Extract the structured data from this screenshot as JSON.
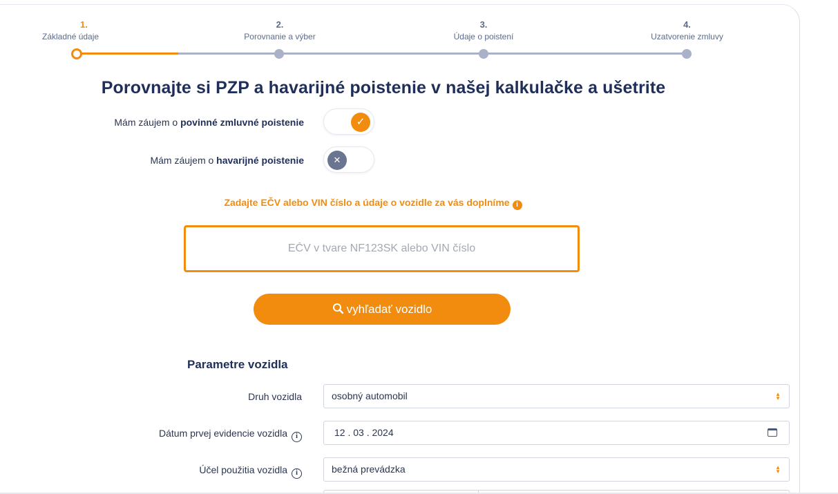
{
  "steps": [
    {
      "number": "1.",
      "label": "Základné údaje"
    },
    {
      "number": "2.",
      "label": "Porovnanie a výber"
    },
    {
      "number": "3.",
      "label": "Údaje o poistení"
    },
    {
      "number": "4.",
      "label": "Uzatvorenie zmluvy"
    }
  ],
  "progress": {
    "current_step": 1,
    "total_steps": 4
  },
  "title": "Porovnajte si PZP a havarijné poistenie v našej kalkulačke a ušetrite",
  "toggles": {
    "pzp": {
      "prefix": "Mám záujem o ",
      "bold": "povinné zmluvné poistenie",
      "state": "on",
      "glyph": "✓"
    },
    "havarijne": {
      "prefix": "Mám záujem o ",
      "bold": "havarijné poistenie",
      "state": "off",
      "glyph": "✕"
    }
  },
  "search": {
    "hint": "Zadajte EČV alebo VIN číslo a údaje o vozidle za vás doplníme",
    "hint_icon": "info-icon",
    "placeholder": "EČV v tvare NF123SK alebo VIN číslo",
    "button_label": "vyhľadať vozidlo",
    "button_icon": "magnifier-icon"
  },
  "vehicle_params": {
    "title": "Parametre vozidla",
    "fields": [
      {
        "label": "Druh vozidla",
        "value": "osobný automobil",
        "type": "select",
        "info": false
      },
      {
        "label": "Dátum prvej evidencie vozidla",
        "value": "12 . 03 . 2024",
        "type": "date",
        "info": true
      },
      {
        "label": "Účel použitia vozidla",
        "value": "bežná prevádzka",
        "type": "select",
        "info": true
      }
    ]
  },
  "colors": {
    "accent": "#f28c0f",
    "primary_text": "#1f2f5a",
    "inactive": "#a9b2c8",
    "toggle_off": "#6a7691"
  }
}
